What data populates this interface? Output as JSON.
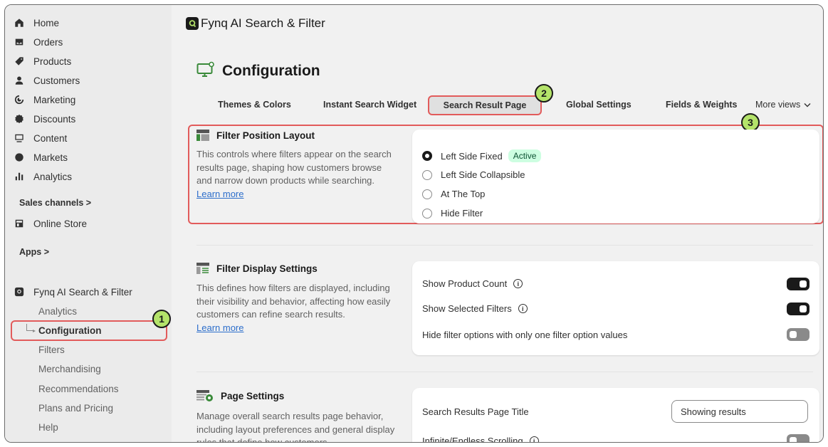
{
  "sidebar": {
    "items": [
      {
        "label": "Home",
        "icon": "home-icon"
      },
      {
        "label": "Orders",
        "icon": "orders-icon"
      },
      {
        "label": "Products",
        "icon": "products-icon"
      },
      {
        "label": "Customers",
        "icon": "customers-icon"
      },
      {
        "label": "Marketing",
        "icon": "marketing-icon"
      },
      {
        "label": "Discounts",
        "icon": "discounts-icon"
      },
      {
        "label": "Content",
        "icon": "content-icon"
      },
      {
        "label": "Markets",
        "icon": "markets-icon"
      },
      {
        "label": "Analytics",
        "icon": "analytics-icon"
      }
    ],
    "sales_channels_label": "Sales channels >",
    "online_store": "Online Store",
    "apps_label": "Apps >",
    "app_name": "Fynq AI Search & Filter",
    "app_subitems": [
      "Analytics",
      "Configuration",
      "Filters",
      "Merchandising",
      "Recommendations",
      "Plans and Pricing",
      "Help"
    ]
  },
  "topbar": {
    "app_title": "Fynq AI Search & Filter"
  },
  "page": {
    "title": "Configuration"
  },
  "tabs": [
    "Themes & Colors",
    "Instant Search Widget",
    "Search Result Page",
    "Global Settings",
    "Fields & Weights"
  ],
  "more_views": "More views",
  "annotations": [
    "1",
    "2",
    "3"
  ],
  "sections": {
    "filter_position": {
      "title": "Filter Position Layout",
      "description": "This controls where filters appear on the search results page, shaping how customers browse and narrow down products while searching.",
      "learn_more": "Learn more",
      "options": [
        "Left Side Fixed",
        "Left Side Collapsible",
        "At The Top",
        "Hide Filter"
      ],
      "selected_index": 0,
      "active_badge": "Active"
    },
    "filter_display": {
      "title": "Filter Display Settings",
      "description": "This defines how filters are displayed, including their visibility and behavior, affecting how easily customers can refine search results.",
      "learn_more": "Learn more",
      "settings": [
        {
          "label": "Show Product Count",
          "info": true,
          "on": true
        },
        {
          "label": "Show Selected Filters",
          "info": true,
          "on": true
        },
        {
          "label": "Hide filter options with only one filter option values",
          "info": false,
          "on": false
        }
      ]
    },
    "page_settings": {
      "title": "Page Settings",
      "description": "Manage overall search results page behavior, including layout preferences and general display rules that define how customers",
      "search_title_label": "Search Results Page Title",
      "search_title_value": "Showing results",
      "infinite_scroll_label": "Infinite/Endless Scrolling",
      "infinite_scroll_on": false
    }
  },
  "colors": {
    "highlight": "#e25b5b",
    "badge": "#b4e36a",
    "active_pill": "#cdfee1"
  }
}
